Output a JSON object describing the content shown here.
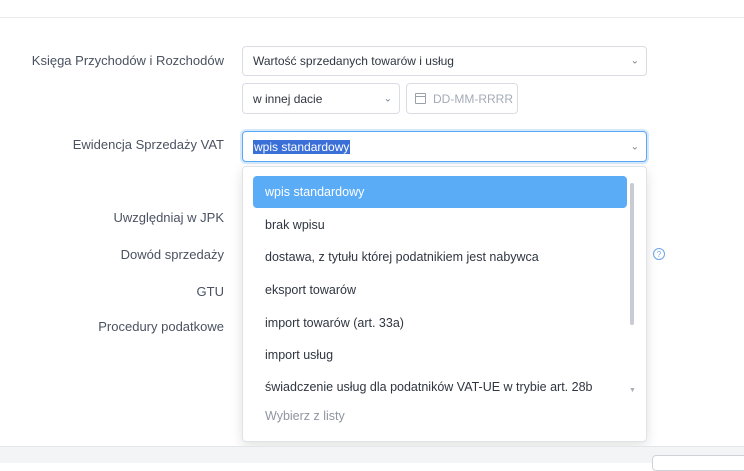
{
  "form": {
    "kpir": {
      "label": "Księga Przychodów i Rozchodów",
      "select_value": "Wartość sprzedanych towarów i usług",
      "date_mode_value": "w innej dacie",
      "date_placeholder": "DD-MM-RRRR"
    },
    "vat": {
      "label": "Ewidencja Sprzedaży VAT",
      "select_value": "wpis standardowy"
    },
    "labels": {
      "jpk": "Uwzględniaj w JPK",
      "proof": "Dowód sprzedaży",
      "gtu": "GTU",
      "procedures": "Procedury podatkowe"
    }
  },
  "dropdown": {
    "options": [
      "wpis standardowy",
      "brak wpisu",
      "dostawa, z tytułu której podatnikiem jest nabywca",
      "eksport towarów",
      "import towarów (art. 33a)",
      "import usług",
      "świadczenie usług dla podatników VAT-UE w trybie art. 28b"
    ],
    "selected_index": 0,
    "placeholder": "Wybierz z listy"
  },
  "icons": {
    "chevron": "chevron-down-icon",
    "calendar": "calendar-icon",
    "help": "question-circle-icon"
  },
  "colors": {
    "accent": "#5aacf7",
    "highlight": "#3a6fd8"
  }
}
